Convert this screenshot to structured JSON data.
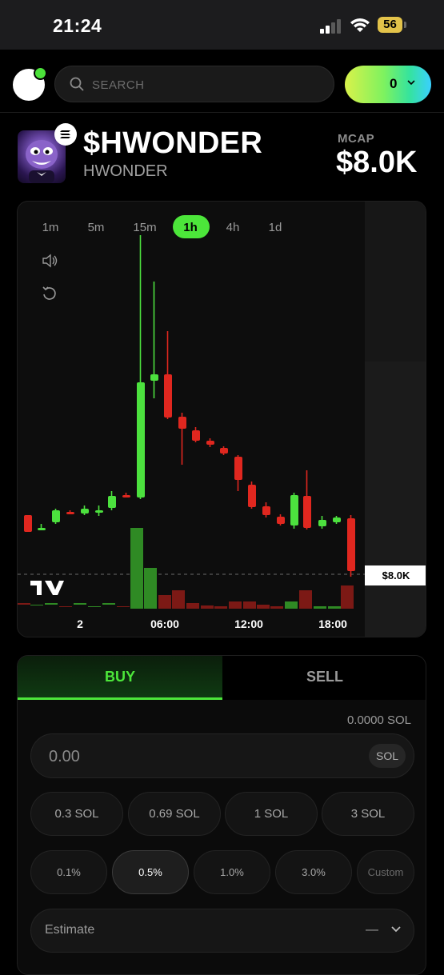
{
  "status_bar": {
    "time": "21:24",
    "battery": "56"
  },
  "header": {
    "search_placeholder": "SEARCH",
    "wallet_balance": "0"
  },
  "token": {
    "ticker": "$HWONDER",
    "name": "HWONDER",
    "mcap_label": "MCAP",
    "mcap_value": "$8.0K"
  },
  "chart": {
    "timeframes": [
      "1m",
      "5m",
      "15m",
      "1h",
      "4h",
      "1d"
    ],
    "active_timeframe": "1h",
    "price_tag": "$8.0K",
    "x_ticks": [
      "2",
      "06:00",
      "12:00",
      "18:00"
    ]
  },
  "chart_data": {
    "type": "candlestick",
    "x_ticks": [
      "2",
      "06:00",
      "12:00",
      "18:00"
    ],
    "current_label": "$8.0K",
    "candles": [
      {
        "dir": "down",
        "size": "small"
      },
      {
        "dir": "up",
        "size": "small"
      },
      {
        "dir": "up",
        "size": "small"
      },
      {
        "dir": "down",
        "size": "small"
      },
      {
        "dir": "up",
        "size": "small"
      },
      {
        "dir": "up",
        "size": "small"
      },
      {
        "dir": "up",
        "size": "small"
      },
      {
        "dir": "down",
        "size": "small"
      },
      {
        "dir": "up",
        "size": "large"
      },
      {
        "dir": "up",
        "size": "small"
      },
      {
        "dir": "down",
        "size": "medium"
      },
      {
        "dir": "down",
        "size": "small"
      },
      {
        "dir": "down",
        "size": "small"
      },
      {
        "dir": "down",
        "size": "small"
      },
      {
        "dir": "down",
        "size": "small"
      },
      {
        "dir": "down",
        "size": "small"
      },
      {
        "dir": "down",
        "size": "small"
      },
      {
        "dir": "down",
        "size": "small"
      },
      {
        "dir": "down",
        "size": "small"
      },
      {
        "dir": "up",
        "size": "small"
      },
      {
        "dir": "down",
        "size": "small"
      },
      {
        "dir": "up",
        "size": "small"
      },
      {
        "dir": "up",
        "size": "small"
      },
      {
        "dir": "down",
        "size": "medium"
      }
    ],
    "colors": {
      "up": "#4ce13e",
      "down": "#e0271f"
    }
  },
  "trade": {
    "buy_label": "BUY",
    "sell_label": "SELL",
    "balance": "0.0000 SOL",
    "amount_placeholder": "0.00",
    "amount_unit": "SOL",
    "quick_amounts": [
      "0.3 SOL",
      "0.69 SOL",
      "1 SOL",
      "3 SOL"
    ],
    "slippage": [
      "0.1%",
      "0.5%",
      "1.0%",
      "3.0%",
      "Custom"
    ],
    "active_slippage": "0.5%",
    "estimate_label": "Estimate",
    "estimate_value": "—"
  },
  "colors": {
    "accent_green": "#4ce63a",
    "down_red": "#e0271f",
    "background": "#000000"
  }
}
